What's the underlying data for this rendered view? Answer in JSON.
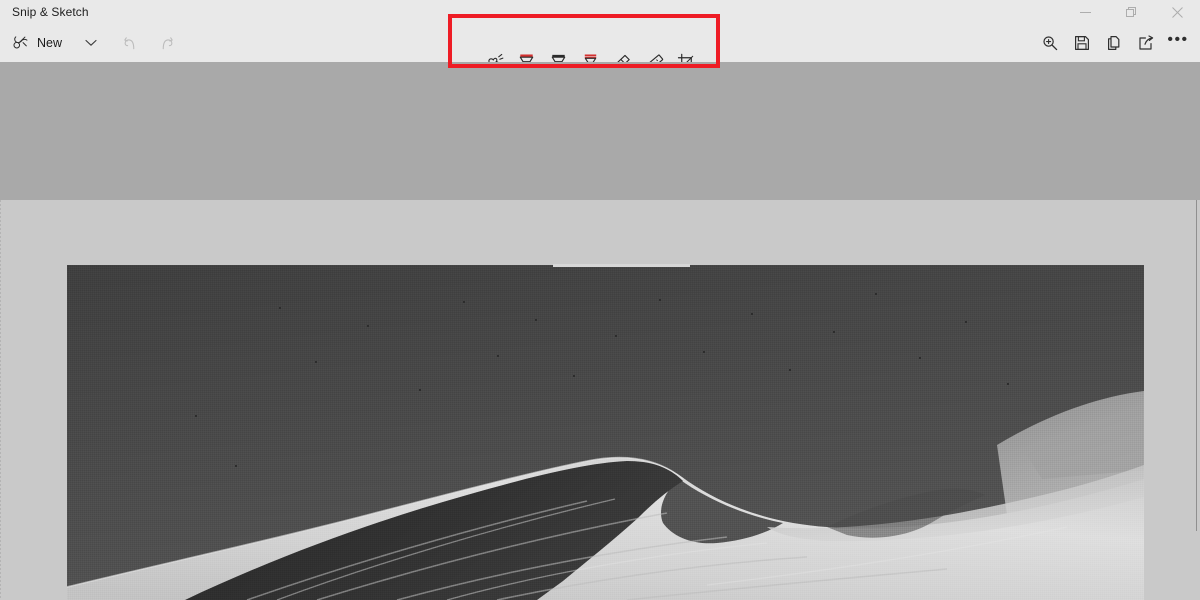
{
  "window": {
    "app_title": "Snip & Sketch",
    "controls": [
      {
        "name": "minimize",
        "glyph": "minimize-icon",
        "label": "Minimize"
      },
      {
        "name": "maximize",
        "glyph": "restore-icon",
        "label": "Restore"
      },
      {
        "name": "close",
        "glyph": "close-icon",
        "label": "Close"
      }
    ]
  },
  "command_bar": {
    "new_button": {
      "label": "New",
      "icon": "snip-scissors-icon"
    },
    "new_dropdown": {
      "icon": "chevron-down-icon",
      "label": "New snip options"
    },
    "undo": {
      "icon": "undo-arrow-icon",
      "label": "Undo",
      "enabled": "false"
    },
    "redo": {
      "icon": "redo-arrow-icon",
      "label": "Redo",
      "enabled": "false"
    }
  },
  "ink_toolbar": {
    "highlight_color": "#ee1c25",
    "selected_tool": "ballpoint-pen",
    "tools": [
      {
        "name": "touch-writing",
        "label": "Touch writing",
        "icon": "touch-writing-icon",
        "selected": "false",
        "has_dropdown": "false"
      },
      {
        "name": "ballpoint-pen",
        "label": "Ballpoint pen",
        "icon": "ballpoint-pen-icon",
        "selected": "true",
        "has_dropdown": "true",
        "ink_color": "#d3302f"
      },
      {
        "name": "pencil",
        "label": "Pencil",
        "icon": "pencil-tool-icon",
        "selected": "false",
        "has_dropdown": "false",
        "ink_color": "#3a3a3a"
      },
      {
        "name": "highlighter",
        "label": "Highlighter",
        "icon": "highlighter-icon",
        "selected": "false",
        "has_dropdown": "false",
        "ink_color": "#d3302f"
      },
      {
        "name": "eraser",
        "label": "Eraser",
        "icon": "eraser-icon",
        "selected": "false",
        "has_dropdown": "false"
      },
      {
        "name": "ruler",
        "label": "Ruler",
        "icon": "ruler-icon",
        "selected": "false",
        "has_dropdown": "false"
      },
      {
        "name": "crop",
        "label": "Crop",
        "icon": "crop-icon",
        "selected": "false",
        "has_dropdown": "false"
      }
    ]
  },
  "actions": [
    {
      "name": "zoom",
      "label": "Zoom",
      "icon": "magnifier-plus-icon"
    },
    {
      "name": "save",
      "label": "Save as",
      "icon": "floppy-save-icon"
    },
    {
      "name": "copy",
      "label": "Copy",
      "icon": "copy-pages-icon"
    },
    {
      "name": "share",
      "label": "Share",
      "icon": "share-arrow-icon"
    },
    {
      "name": "more",
      "label": "See more",
      "icon": "ellipsis-icon",
      "glyph": "•••"
    }
  ],
  "canvas": {
    "snip": {
      "description": "Grayscale photograph of a sand dune ridge against a dark sky",
      "alt_name": "snipped-screenshot-image"
    },
    "scrollbars": {
      "horizontal": "horizontal-scrollbar-thumb",
      "vertical": "vertical-scrollbar-track"
    }
  },
  "annotation": {
    "name": "red-highlight-rectangle",
    "color": "#ee1c25",
    "target": "ink-toolbar"
  }
}
